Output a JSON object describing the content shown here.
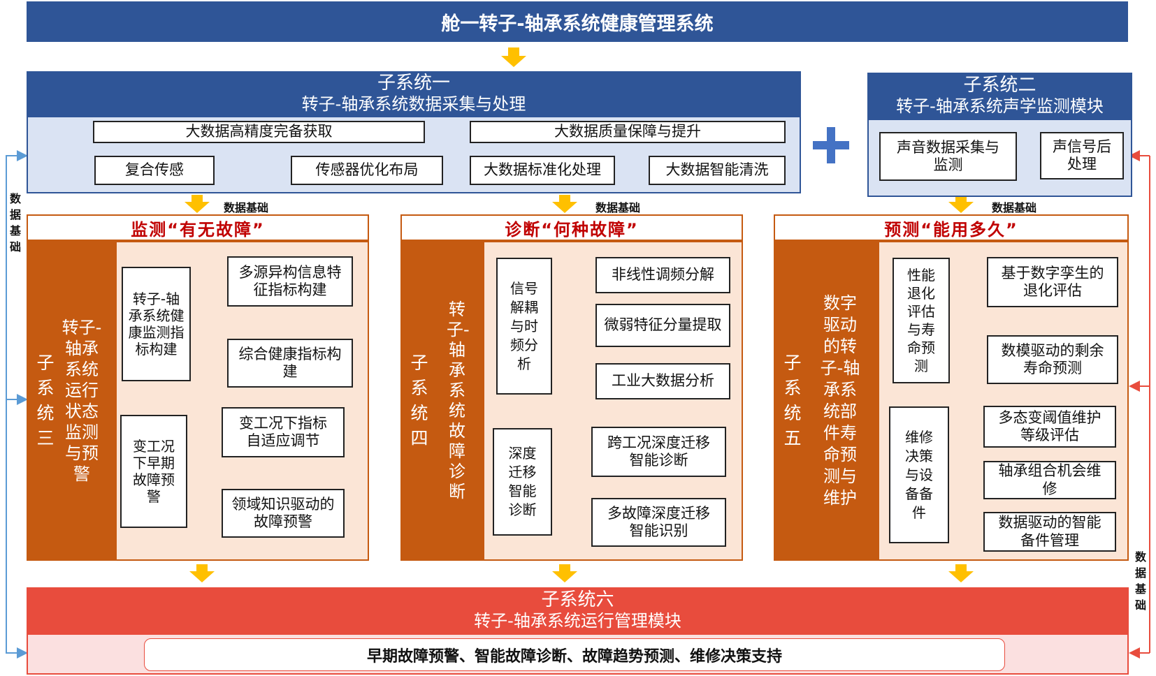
{
  "header": {
    "title": "舱一转子-轴承系统健康管理系统"
  },
  "sub1": {
    "title": "子系统一",
    "subtitle": "转子-轴承系统数据采集与处理",
    "group1": {
      "title": "大数据高精度完备获取",
      "items": [
        "复合传感",
        "传感器优化布局"
      ]
    },
    "group2": {
      "title": "大数据质量保障与提升",
      "items": [
        "大数据标准化处理",
        "大数据智能清洗"
      ]
    }
  },
  "plus": "+",
  "sub2": {
    "title": "子系统二",
    "subtitle": "转子-轴承系统声学监测模块",
    "items": [
      "声音数据采集与监测",
      "声信号后处理"
    ]
  },
  "data_basis": "数据基础",
  "sub3": {
    "head": "监测“有无故障”",
    "label": "子系统三",
    "name": "转子-轴承系统运行状态监测与预警",
    "group1": {
      "title": "转子-轴承系统健康监测指标构建",
      "items": [
        "多源异构信息特征指标构建",
        "综合健康指标构建"
      ]
    },
    "group2": {
      "title": "变工况下早期故障预警",
      "items": [
        "变工况下指标自适应调节",
        "领域知识驱动的故障预警"
      ]
    }
  },
  "sub4": {
    "head": "诊断“何种故障”",
    "label": "子系统四",
    "name": "转子-轴承系统故障诊断",
    "group1": {
      "title": "信号解耦与时频分析",
      "items": [
        "非线性调频分解",
        "微弱特征分量提取",
        "工业大数据分析"
      ]
    },
    "group2": {
      "title": "深度迁移智能诊断",
      "items": [
        "跨工况深度迁移智能诊断",
        "多故障深度迁移智能识别"
      ]
    }
  },
  "sub5": {
    "head": "预测“能用多久”",
    "label": "子系统五",
    "name": "数字驱动的转子-轴承系统部件寿命预测与维护",
    "group1": {
      "title": "性能退化评估与寿命预测",
      "items": [
        "基于数字孪生的退化评估",
        "数模驱动的剩余寿命预测"
      ]
    },
    "group2": {
      "title": "维修决策与设备备件",
      "items": [
        "多态变阈值维护等级评估",
        "轴承组合机会维修",
        "数据驱动的智能备件管理"
      ]
    }
  },
  "sub6": {
    "title": "子系统六",
    "subtitle": "转子-轴承系统运行管理模块",
    "summary": "早期故障预警、智能故障诊断、故障趋势预测、维修决策支持"
  },
  "colors": {
    "blue": "#2f5597",
    "light_blue": "#dae3f3",
    "orange": "#c55a11",
    "peach": "#fbe5d6",
    "red": "#e84c3d",
    "arrow": "#ffc000",
    "plus": "#4472c4"
  }
}
